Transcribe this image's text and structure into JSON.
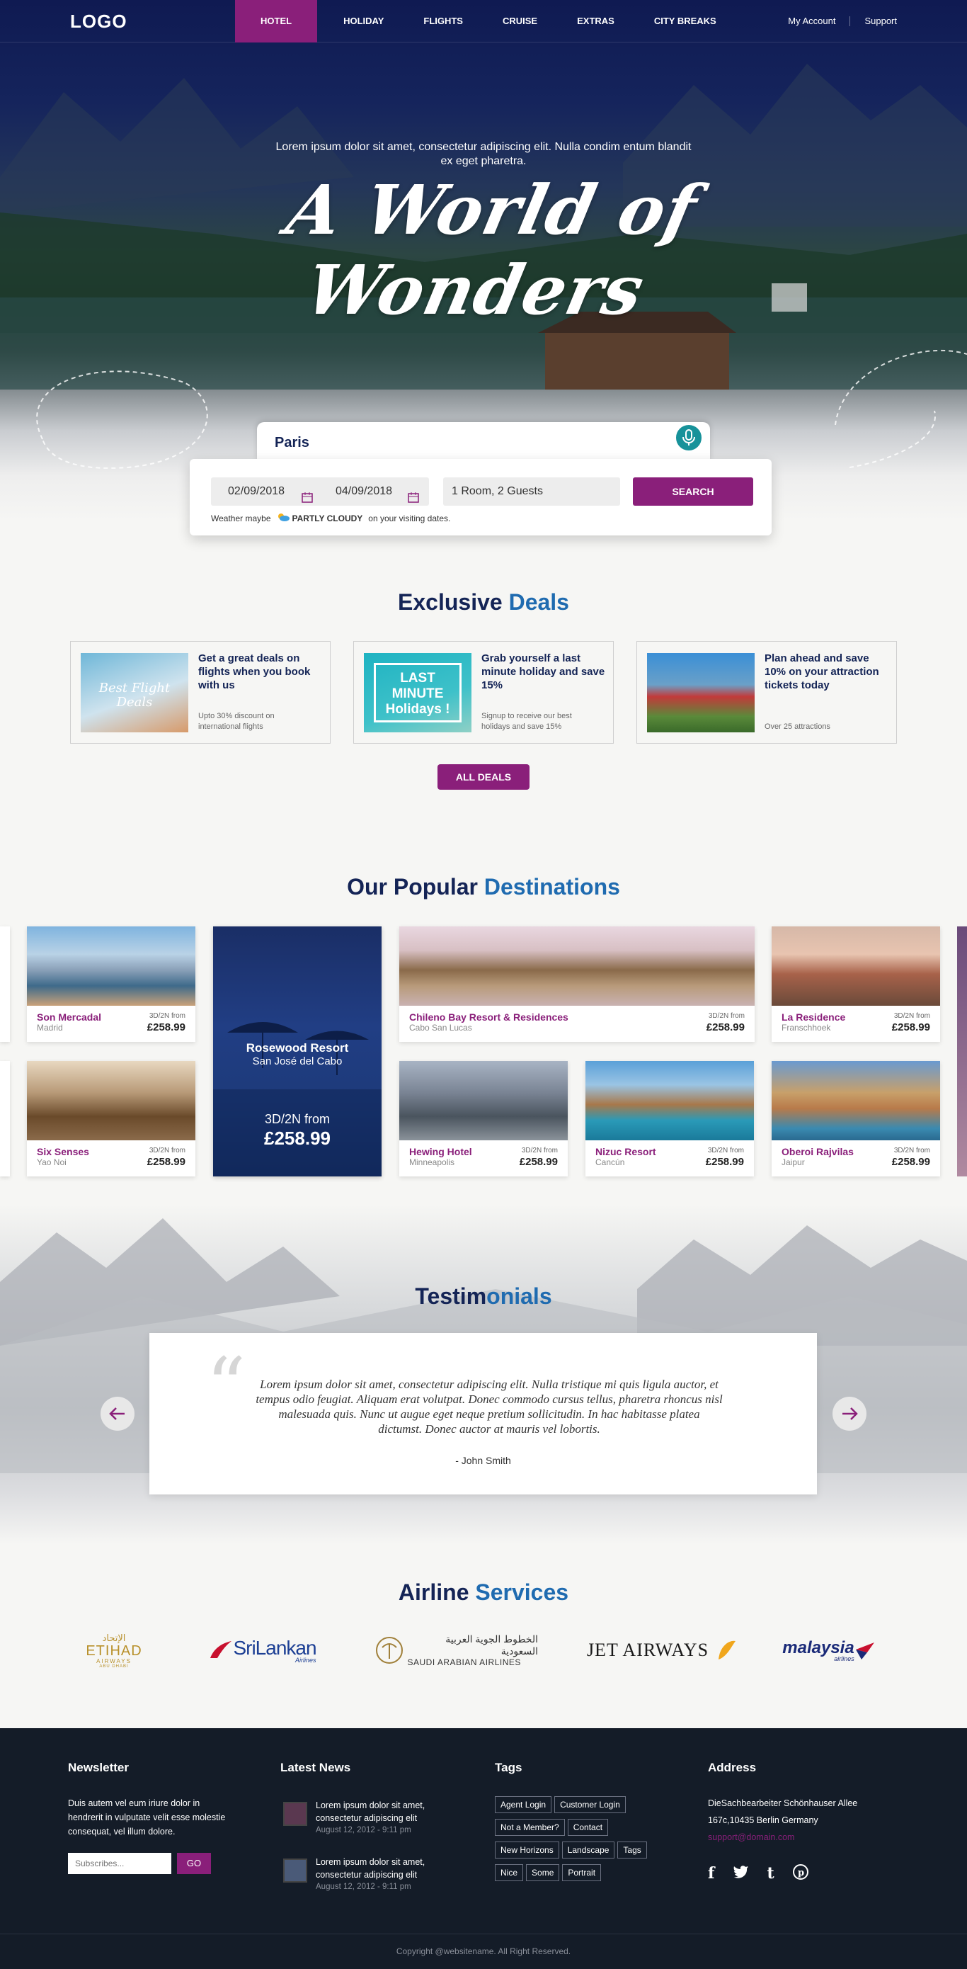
{
  "nav": {
    "logo": "LOGO",
    "items": [
      "HOTEL",
      "HOLIDAY",
      "FLIGHTS",
      "CRUISE",
      "EXTRAS",
      "CITY BREAKS"
    ],
    "account": "My Account",
    "support": "Support"
  },
  "hero": {
    "subtitle": "Lorem ipsum dolor sit amet, consectetur adipiscing elit. Nulla condim entum blandit ex eget pharetra.",
    "title": "A World of Wonders"
  },
  "search": {
    "city": "Paris",
    "checkin": "02/09/2018",
    "checkout": "04/09/2018",
    "guests": "1 Room, 2 Guests",
    "button": "SEARCH",
    "weather_prefix": "Weather maybe",
    "weather_state": "PARTLY CLOUDY",
    "weather_suffix": "on your visiting dates."
  },
  "deals": {
    "title_a": "Exclusive",
    "title_b": "Deals",
    "items": [
      {
        "title": "Get a great deals on flights when you book with us",
        "desc": "Upto 30% discount on international flights",
        "img_text": "Best Flight Deals"
      },
      {
        "title": "Grab yourself a last minute holiday and save 15%",
        "desc": "Signup to receive our best holidays and save 15%",
        "img_text": "LAST MINUTE Holidays !"
      },
      {
        "title": "Plan ahead and save 10% on your attraction tickets today",
        "desc": "Over 25 attractions",
        "img_text": ""
      }
    ],
    "button": "ALL DEALS"
  },
  "destinations": {
    "title_a": "Our Popular",
    "title_b": "Destinations",
    "featured": {
      "name": "Rosewood Resort",
      "place": "San José del Cabo",
      "from": "3D/2N from",
      "price": "£258.99"
    },
    "cards": [
      {
        "name": "Son Mercadal",
        "loc": "Madrid",
        "from": "3D/2N from",
        "price": "£258.99"
      },
      {
        "name": "Chileno Bay Resort & Residences",
        "loc": "Cabo San Lucas",
        "from": "3D/2N from",
        "price": "£258.99"
      },
      {
        "name": "La Residence",
        "loc": "Franschhoek",
        "from": "3D/2N from",
        "price": "£258.99"
      },
      {
        "name": "Six Senses",
        "loc": "Yao Noi",
        "from": "3D/2N from",
        "price": "£258.99"
      },
      {
        "name": "Hewing Hotel",
        "loc": "Minneapolis",
        "from": "3D/2N from",
        "price": "£258.99"
      },
      {
        "name": "Nizuc Resort",
        "loc": "Cancún",
        "from": "3D/2N from",
        "price": "£258.99"
      },
      {
        "name": "Oberoi Rajvilas",
        "loc": "Jaipur",
        "from": "3D/2N from",
        "price": "£258.99"
      }
    ]
  },
  "testimonials": {
    "title_a": "Testim",
    "title_b": "onials",
    "quote": "Lorem ipsum dolor sit amet, consectetur adipiscing elit. Nulla tristique mi quis ligula auctor, et tempus odio feugiat. Aliquam erat volutpat. Donec commodo cursus tellus, pharetra rhoncus nisl malesuada quis. Nunc ut augue eget neque pretium sollicitudin. In hac habitasse platea dictumst. Donec auctor at mauris vel lobortis.",
    "author": "- John Smith"
  },
  "airlines": {
    "title_a": "Airline",
    "title_b": "Services",
    "etihad": "ETIHAD",
    "etihad_ar": "الإتحاد",
    "etihad_sub": "AIRWAYS",
    "etihad_city": "ABU DHABI",
    "srilankan": "SriLankan",
    "srilankan_sub": "Airlines",
    "saudi_ar": "الخطوط الجوية العربية السعودية",
    "saudi": "SAUDI ARABIAN AIRLINES",
    "jet": "JET AIRWAYS",
    "malaysia": "malaysia",
    "malaysia_sub": "airlines"
  },
  "footer": {
    "newsletter_title": "Newsletter",
    "newsletter_text": "Duis autem vel eum iriure dolor in hendrerit in vulputate velit esse molestie consequat, vel illum dolore.",
    "newsletter_placeholder": "Subscribes...",
    "newsletter_button": "GO",
    "news_title": "Latest News",
    "news": [
      {
        "title": "Lorem ipsum dolor sit amet, consectetur adipiscing elit",
        "date": "August 12, 2012 - 9:11 pm"
      },
      {
        "title": "Lorem ipsum dolor sit amet, consectetur adipiscing elit",
        "date": "August 12, 2012 - 9:11 pm"
      }
    ],
    "tags_title": "Tags",
    "tags": [
      "Agent Login",
      "Customer Login",
      "Not a Member?",
      "Contact",
      "New Horizons",
      "Landscape",
      "Tags",
      "Nice",
      "Some",
      "Portrait"
    ],
    "address_title": "Address",
    "address_1": "DieSachbearbeiter Schönhauser Allee",
    "address_2": "167c,10435 Berlin Germany",
    "email": "support@domain.com",
    "copyright": "Copyright @websitename. All Right Reserved."
  },
  "colors": {
    "brand": "#8a1f7a",
    "navy": "#142456",
    "accent_blue": "#1f6bb0",
    "footer": "#141c28"
  }
}
